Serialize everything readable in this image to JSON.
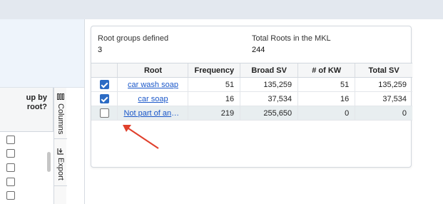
{
  "left_panel": {
    "column_header": "up by root?",
    "row_count": 5,
    "tabs": [
      {
        "label": "Columns",
        "icon": "columns-icon"
      },
      {
        "label": "Export",
        "icon": "export-icon"
      }
    ]
  },
  "summary": {
    "root_groups_label": "Root groups defined",
    "root_groups_value": "3",
    "total_roots_label": "Total Roots in the MKL",
    "total_roots_value": "244"
  },
  "table": {
    "columns": [
      "Root",
      "Frequency",
      "Broad SV",
      "# of KW",
      "Total SV"
    ],
    "rows": [
      {
        "checked": true,
        "root": "car wash soap",
        "frequency": "51",
        "broad_sv": "135,259",
        "kw": "51",
        "total_sv": "135,259"
      },
      {
        "checked": true,
        "root": "car soap",
        "frequency": "16",
        "broad_sv": "37,534",
        "kw": "16",
        "total_sv": "37,534"
      },
      {
        "checked": false,
        "root": "Not part of any root",
        "frequency": "219",
        "broad_sv": "255,650",
        "kw": "0",
        "total_sv": "0"
      }
    ]
  },
  "colors": {
    "accent": "#2c6bc4",
    "link": "#1a57c9",
    "annotation_arrow": "#e0402c"
  }
}
